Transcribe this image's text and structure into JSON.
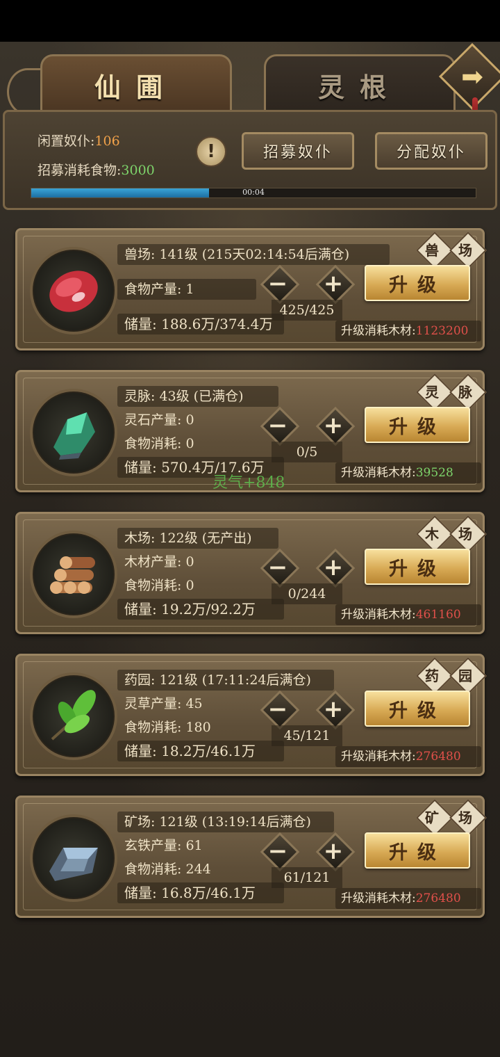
{
  "tabs": {
    "active": "仙圃",
    "inactive": "灵根"
  },
  "workers": {
    "idle_label": "闲置奴仆:",
    "idle_value": "106",
    "cost_label": "招募消耗食物:",
    "cost_value": "3000",
    "recruit_button": "招募奴仆",
    "assign_button": "分配奴仆",
    "alert": "!",
    "progress_time": "00:04",
    "progress_fraction": 0.4
  },
  "upgrade_label": "升级",
  "wood_cost_label": "升级消耗木材:",
  "buildings": [
    {
      "title": "兽场: 141级 (215天02:14:54后满仓)",
      "prod": "食物产量: 1",
      "cons": "",
      "storage": "储量: 188.6万/374.4万",
      "counter": "425/425",
      "tag1": "兽",
      "tag2": "场",
      "wood_cost": "1123200",
      "cost_color": "red"
    },
    {
      "title": "灵脉: 43级 (已满仓)",
      "prod": "灵石产量: 0",
      "cons": "食物消耗: 0",
      "storage": "储量: 570.4万/17.6万",
      "counter": "0/5",
      "tag1": "灵",
      "tag2": "脉",
      "wood_cost": "39528",
      "cost_color": "green"
    },
    {
      "title": "木场: 122级 (无产出)",
      "prod": "木材产量: 0",
      "cons": "食物消耗: 0",
      "storage": "储量: 19.2万/92.2万",
      "counter": "0/244",
      "tag1": "木",
      "tag2": "场",
      "wood_cost": "461160",
      "cost_color": "red"
    },
    {
      "title": "药园: 121级 (17:11:24后满仓)",
      "prod": "灵草产量: 45",
      "cons": "食物消耗: 180",
      "storage": "储量: 18.2万/46.1万",
      "counter": "45/121",
      "tag1": "药",
      "tag2": "园",
      "wood_cost": "276480",
      "cost_color": "red"
    },
    {
      "title": "矿场: 121级 (13:19:14后满仓)",
      "prod": "玄铁产量: 61",
      "cons": "食物消耗: 244",
      "storage": "储量: 16.8万/46.1万",
      "counter": "61/121",
      "tag1": "矿",
      "tag2": "场",
      "wood_cost": "276480",
      "cost_color": "red"
    }
  ],
  "float_text": "灵气+848",
  "icons": [
    "meat-icon",
    "crystal-icon",
    "logs-icon",
    "herb-icon",
    "iron-ingot-icon"
  ]
}
